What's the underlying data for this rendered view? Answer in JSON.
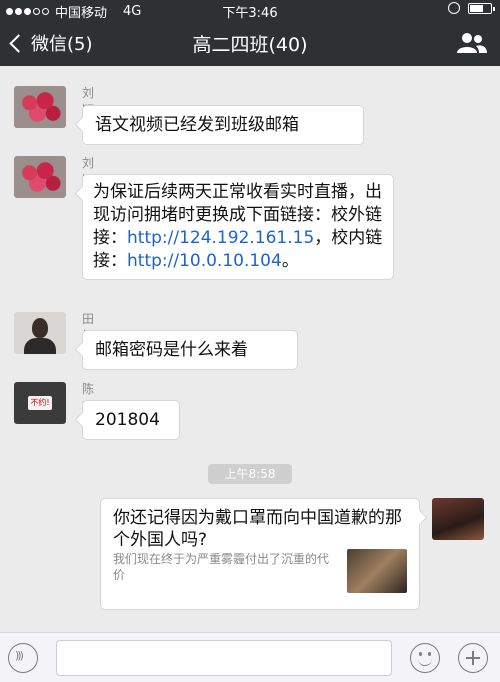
{
  "status_bar": {
    "carrier": "中国移动",
    "network": "4G",
    "time": "下午3:46"
  },
  "nav": {
    "back_label": "微信(5)",
    "title": "高二四班(40)"
  },
  "messages": [
    {
      "sender": "刘颖",
      "text": "语文视频已经发到班级邮箱"
    },
    {
      "sender": "刘颖",
      "text_parts": [
        "为保证后续两天正常收看实时直播，出现访问拥堵时更换成下面链接：校外链接：",
        "http://124.192.161.15",
        "，校内链接：",
        "http://10.0.10.104",
        "。"
      ]
    },
    {
      "sender": "田怡然",
      "text": "邮箱密码是什么来着"
    },
    {
      "sender": "陈爽",
      "text": "201804",
      "avatar_sign": "不约!"
    }
  ],
  "time_divider": "上午8:58",
  "shared_card": {
    "title": "你还记得因为戴口罩而向中国道歉的那个外国人吗?",
    "description": "我们现在终于为严重雾霾付出了沉重的代价"
  },
  "colors": {
    "nav_background": "#2e3132",
    "chat_background": "#ebebeb",
    "link": "#1a64d1"
  },
  "icons": [
    "back-chevron-icon",
    "group-members-icon",
    "voice-icon",
    "emoji-icon",
    "plus-icon"
  ]
}
